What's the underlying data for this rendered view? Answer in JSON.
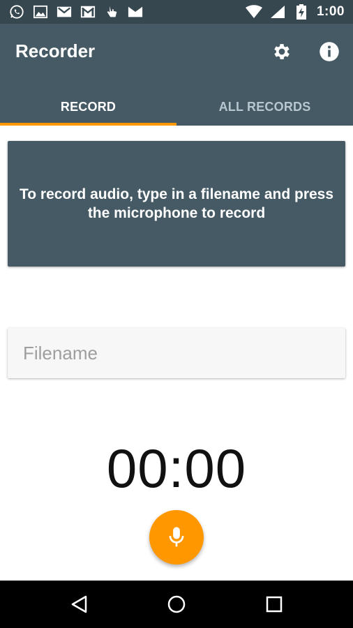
{
  "status_bar": {
    "time": "1:00",
    "left_icons": [
      "whatsapp-icon",
      "image-icon",
      "gmail-icon",
      "gmail-icon",
      "touch-icon",
      "gmail-icon"
    ],
    "right_icons": [
      "wifi-icon",
      "cell-signal-icon",
      "battery-charging-icon"
    ]
  },
  "app_bar": {
    "title": "Recorder",
    "actions": [
      "settings-icon",
      "info-icon"
    ]
  },
  "tabs": [
    {
      "label": "RECORD",
      "active": true
    },
    {
      "label": "ALL RECORDS",
      "active": false
    }
  ],
  "info_card": {
    "text": "To record audio, type in a filename and press the microphone to record"
  },
  "filename": {
    "placeholder": "Filename",
    "value": ""
  },
  "timer": {
    "value": "00:00"
  },
  "fab": {
    "icon": "microphone-icon"
  },
  "nav_bar": {
    "icons": [
      "back-icon",
      "home-icon",
      "recents-icon"
    ]
  },
  "colors": {
    "status_bar": "#37474f",
    "app_bar": "#455a64",
    "accent": "#ff9800",
    "card": "#455a64"
  }
}
